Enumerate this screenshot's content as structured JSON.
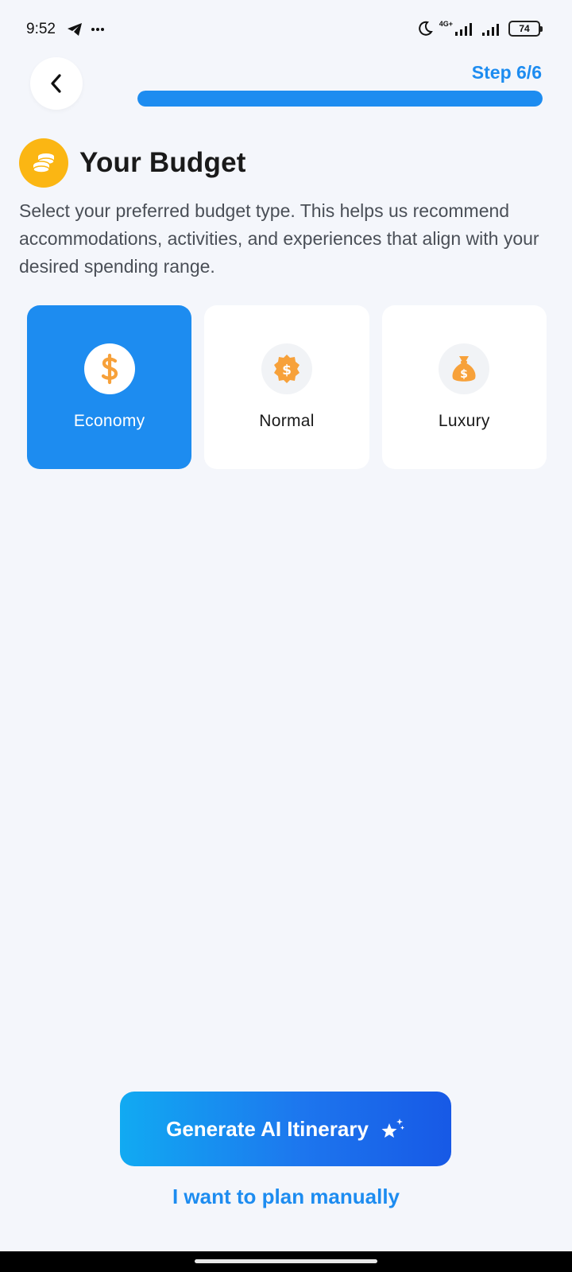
{
  "status_bar": {
    "time": "9:52",
    "network": "4G+",
    "battery": "74"
  },
  "header": {
    "step_label": "Step 6/6",
    "progress_fraction": 1.0
  },
  "page": {
    "title": "Your Budget",
    "description": "Select your preferred budget type. This helps us recommend accommodations, activities, and experiences that align with your desired spending range."
  },
  "options": [
    {
      "label": "Economy",
      "icon": "dollar-sign-icon",
      "selected": true
    },
    {
      "label": "Normal",
      "icon": "dollar-badge-icon",
      "selected": false
    },
    {
      "label": "Luxury",
      "icon": "money-bag-icon",
      "selected": false
    }
  ],
  "actions": {
    "generate_label": "Generate AI Itinerary",
    "generate_icon": "sparkle-star-icon",
    "manual_label": "I want to plan manually"
  },
  "colors": {
    "accent": "#1d8cf0",
    "icon_orange": "#f7a13a",
    "title_icon_bg": "#fbb613",
    "background": "#f4f6fb"
  }
}
